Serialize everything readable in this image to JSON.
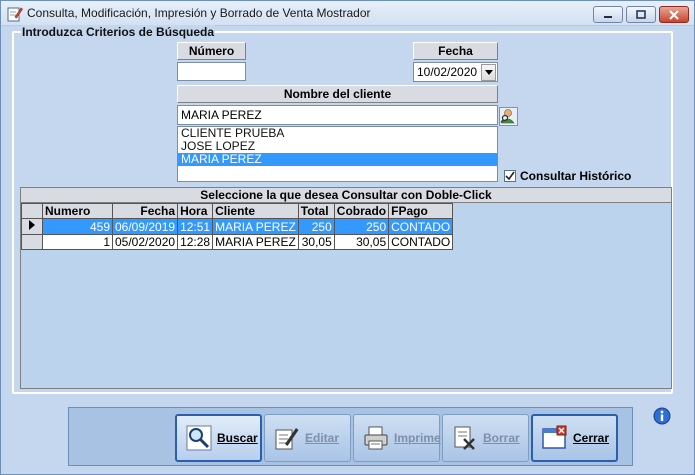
{
  "window": {
    "title": "Consulta, Modificación, Impresión y Borrado de Venta Mostrador"
  },
  "criteria": {
    "legend": "Introduzca Criterios de Búsqueda",
    "numero_label": "Número",
    "numero_value": "",
    "fecha_label": "Fecha",
    "fecha_value": "10/02/2020",
    "cliente_label": "Nombre del cliente",
    "cliente_value": "MARIA PEREZ",
    "client_list": [
      "CLIENTE PRUEBA",
      "JOSE LOPEZ",
      "MARIA PEREZ"
    ],
    "client_list_selected_index": 2,
    "historico_label": "Consultar Histórico",
    "historico_checked": true
  },
  "grid": {
    "title": "Seleccione la que desea Consultar con Doble-Click",
    "columns": [
      "Numero",
      "Fecha",
      "Hora",
      "Cliente",
      "Total",
      "Cobrado",
      "FPago"
    ],
    "rows": [
      {
        "numero": "459",
        "fecha": "06/09/2019",
        "hora": "12:51",
        "cliente": "MARIA PEREZ",
        "total": "250",
        "cobrado": "250",
        "fpago": "CONTADO"
      },
      {
        "numero": "1",
        "fecha": "05/02/2020",
        "hora": "12:28",
        "cliente": "MARIA PEREZ",
        "total": "30,05",
        "cobrado": "30,05",
        "fpago": "CONTADO"
      }
    ],
    "selected_row": 0
  },
  "toolbar": {
    "buscar": "Buscar",
    "editar": "Editar",
    "imprime": "Imprime",
    "borrar": "Borrar",
    "cerrar": "Cerrar"
  },
  "colors": {
    "window_bg": "#c4d7ee",
    "selection": "#3399ff",
    "header_bg": "#d9dbe2"
  }
}
